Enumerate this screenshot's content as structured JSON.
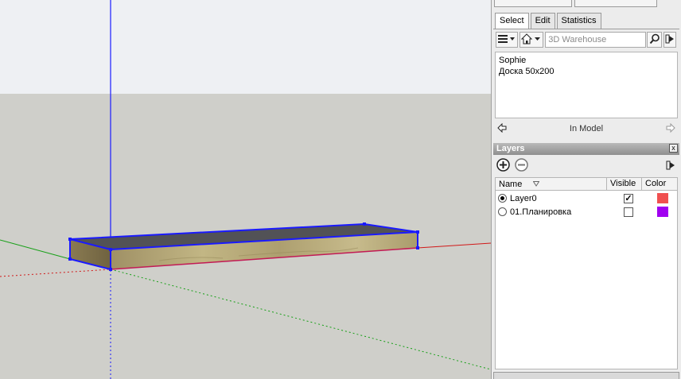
{
  "components": {
    "tabs": [
      {
        "label": "Select",
        "active": true
      },
      {
        "label": "Edit",
        "active": false
      },
      {
        "label": "Statistics",
        "active": false
      }
    ],
    "search": {
      "placeholder": "3D Warehouse"
    },
    "info": {
      "line1": "Sophie",
      "line2": "Доска 50x200"
    },
    "nav": {
      "label": "In Model"
    }
  },
  "layers": {
    "title": "Layers",
    "close_glyph": "x",
    "columns": {
      "name": "Name",
      "visible": "Visible",
      "color": "Color"
    },
    "items": [
      {
        "name": "Layer0",
        "active": true,
        "visible": true,
        "color": "#f05050"
      },
      {
        "name": "01.Планировка",
        "active": false,
        "visible": false,
        "color": "#a000f0"
      }
    ]
  },
  "colors": {
    "sky": "#eef0f3",
    "ground": "#cfcfca",
    "edge_blue": "#1a1aff",
    "axis_red": "#d01818",
    "axis_green": "#18a018",
    "wood": "#b9ab77"
  },
  "icons": {
    "components_menu": "list-menu-icon",
    "home": "home-icon",
    "search": "magnifier-icon",
    "details": "details-arrow-icon",
    "back": "back-arrow-icon",
    "forward": "forward-arrow-icon",
    "add_layer": "add-circle-icon",
    "remove_layer": "remove-circle-icon",
    "layer_details": "details-arrow-icon",
    "sort": "sort-triangle-icon"
  }
}
